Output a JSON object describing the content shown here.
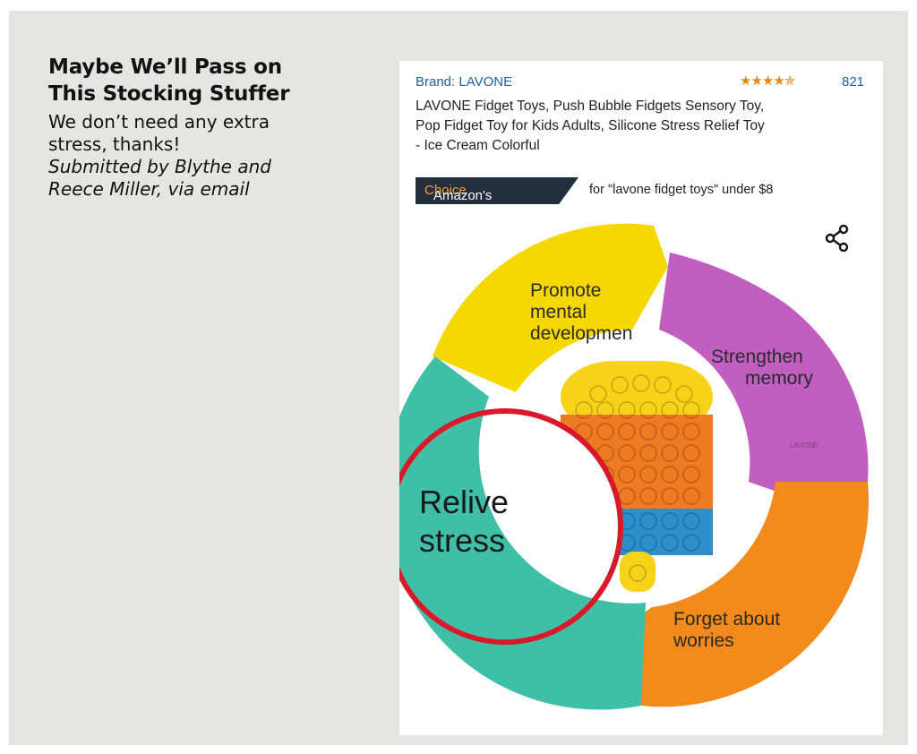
{
  "caption": {
    "headline_line1": "Maybe We’ll Pass on",
    "headline_line2": "This Stocking Stuffer",
    "body_line1": "We don’t need any extra",
    "body_line2": "stress, thanks!",
    "credit_line1": "Submitted by Blythe and",
    "credit_line2": "Reece Miller, via email"
  },
  "listing": {
    "brand": "Brand: LAVONE",
    "stars": "★★★★✯",
    "rating_fraction": 0.9,
    "review_count": "821",
    "title_line1": "LAVONE Fidget Toys, Push Bubble Fidgets Sensory Toy,",
    "title_line2": "Pop Fidget Toy for Kids Adults, Silicone Stress Relief Toy",
    "title_line3": "- Ice Cream Colorful",
    "badge_prefix": "Amazon's",
    "badge_accent": "Choice",
    "badge_note": "for \"lavone fidget toys\" under $8",
    "share_icon": "share-icon"
  },
  "image": {
    "segment_top_line1": "Promote",
    "segment_top_line2": "mental",
    "segment_top_line3": "developmen",
    "segment_right_line1": "Strengthen",
    "segment_right_line2": "memory",
    "watermark": "LAVONE",
    "segment_bottom_line1": "Forget about",
    "segment_bottom_line2": "worries",
    "circled_line1": "Relive",
    "circled_line2": "stress",
    "colors": {
      "yellow": "#f5d800",
      "purple": "#c05fc0",
      "orange": "#f28a1c",
      "teal": "#3fbfa8",
      "highlight_ring": "#d7192a"
    }
  }
}
